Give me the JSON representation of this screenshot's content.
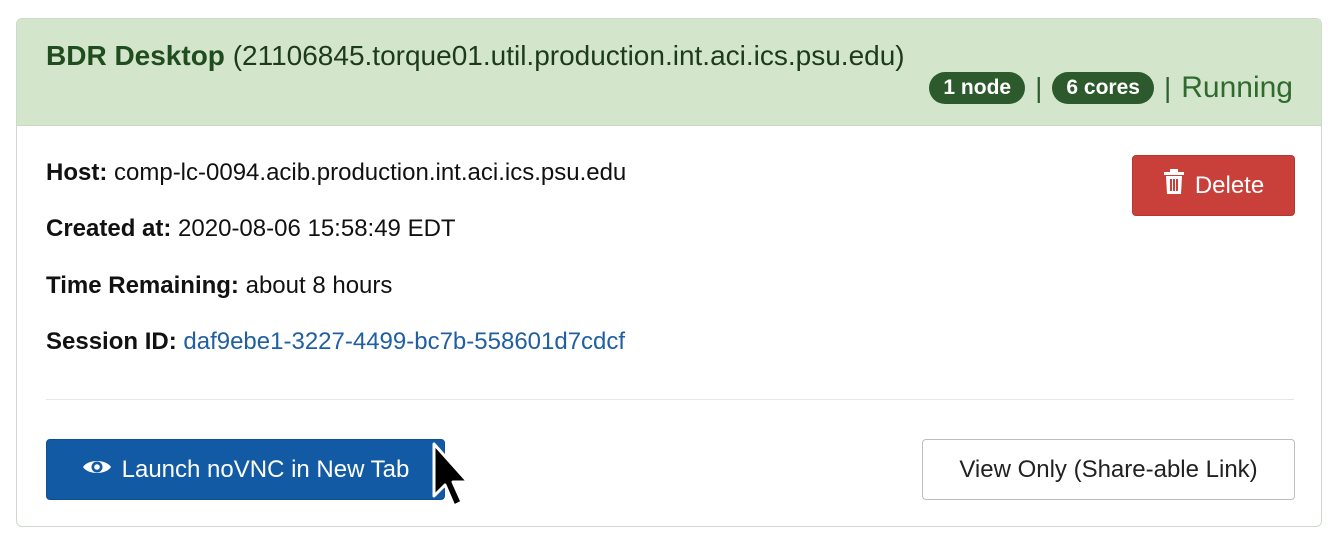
{
  "session": {
    "app_name": "BDR Desktop",
    "job_id": "(21106845.torque01.util.production.int.aci.ics.psu.edu)",
    "nodes_badge": "1 node",
    "cores_badge": "6 cores",
    "separator": "|",
    "status": "Running",
    "host_label": "Host:",
    "host_value": "comp-lc-0094.acib.production.int.aci.ics.psu.edu",
    "created_label": "Created at:",
    "created_value": "2020-08-06 15:58:49 EDT",
    "remaining_label": "Time Remaining:",
    "remaining_value": "about 8 hours",
    "session_label": "Session ID:",
    "session_value": "daf9ebe1-3227-4499-bc7b-558601d7cdcf"
  },
  "buttons": {
    "delete_label": "Delete",
    "delete_icon": "trash-icon",
    "launch_label": "Launch noVNC in New Tab",
    "launch_icon": "eye-icon",
    "view_only_label": "View Only (Share-able Link)"
  },
  "colors": {
    "header_bg": "#d3e5cb",
    "badge_bg": "#2d5a2d",
    "delete_bg": "#c9403a",
    "launch_bg": "#125aa3",
    "link": "#1f5fa2"
  }
}
